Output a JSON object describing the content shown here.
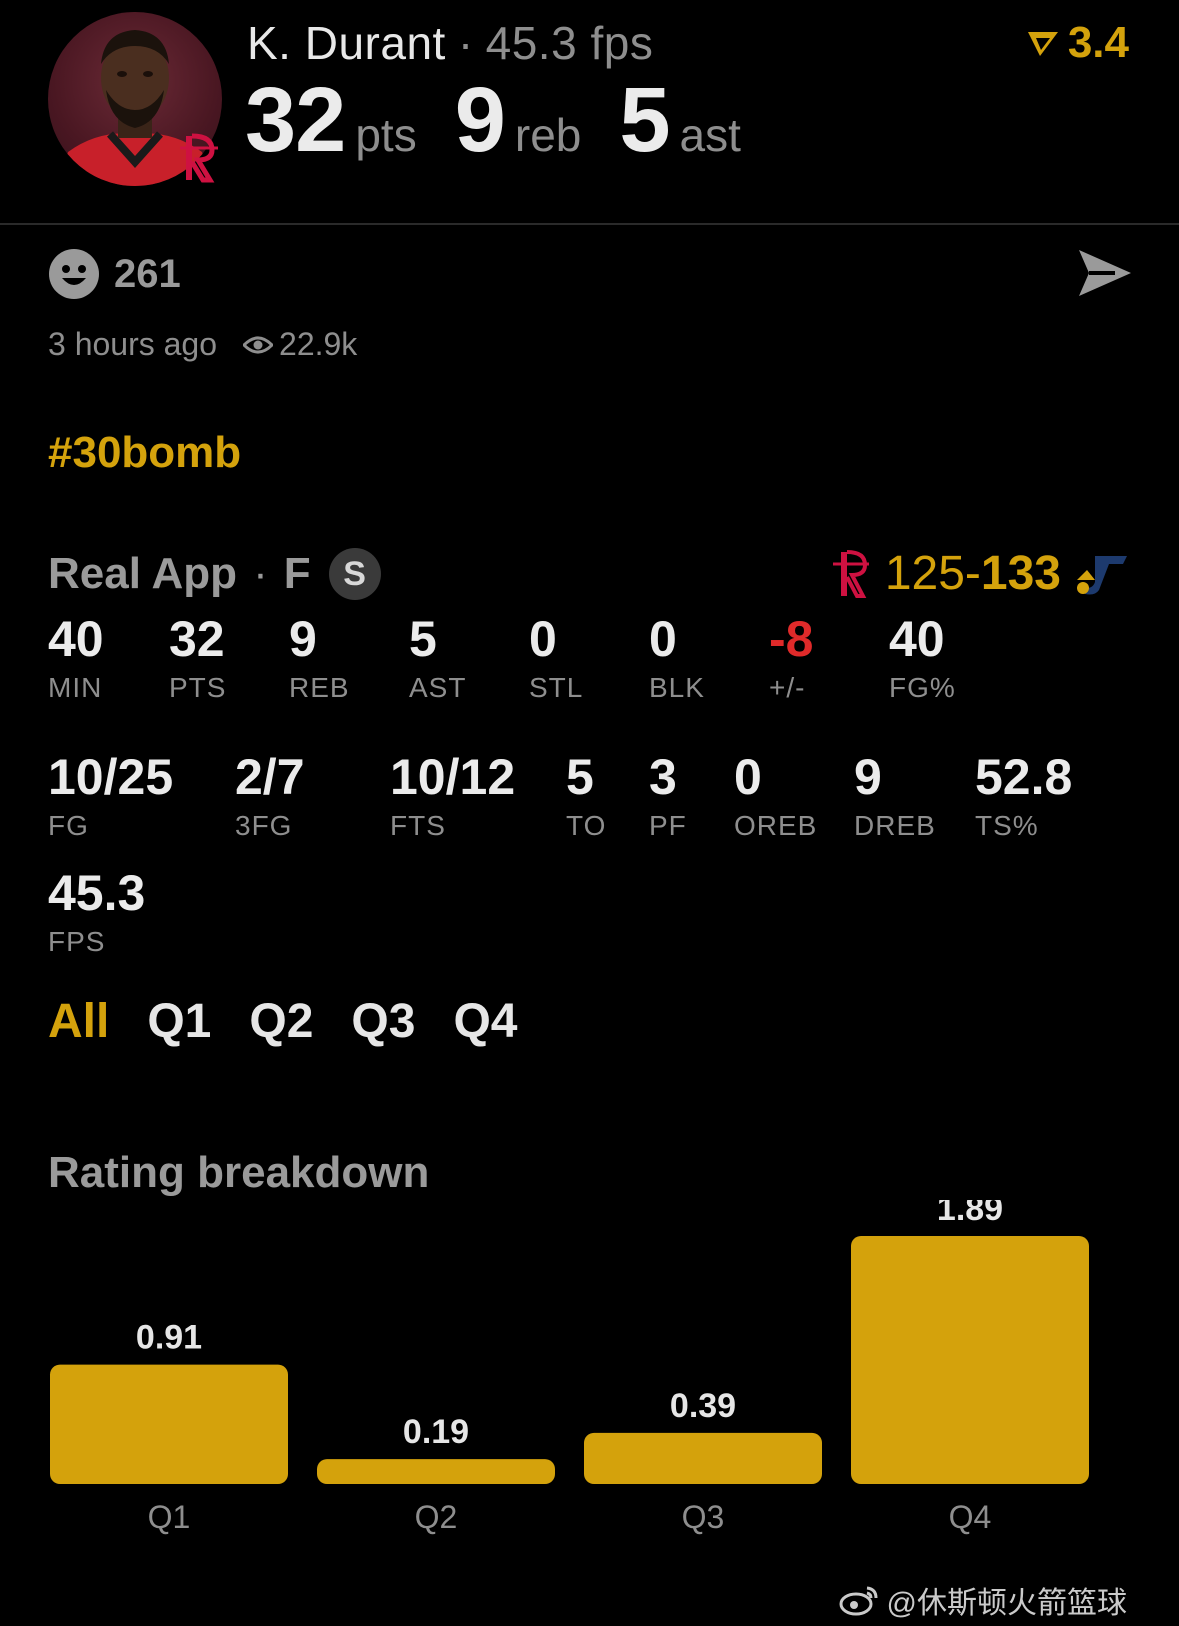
{
  "player": {
    "name": "K. Durant",
    "fps_label": "45.3 fps",
    "rating": "3.4",
    "pts": "32",
    "pts_unit": "pts",
    "reb": "9",
    "reb_unit": "reb",
    "ast": "5",
    "ast_unit": "ast"
  },
  "social": {
    "reaction_count": "261",
    "time_ago": "3 hours ago",
    "views": "22.9k",
    "hashtag": "#30bomb"
  },
  "game": {
    "app": "Real App",
    "status": "F",
    "badge": "S",
    "home_score": "125",
    "separator": "-",
    "away_score": "133"
  },
  "stats": [
    {
      "value": "40",
      "label": "MIN"
    },
    {
      "value": "32",
      "label": "PTS"
    },
    {
      "value": "9",
      "label": "REB"
    },
    {
      "value": "5",
      "label": "AST"
    },
    {
      "value": "0",
      "label": "STL"
    },
    {
      "value": "0",
      "label": "BLK"
    },
    {
      "value": "-8",
      "label": "+/-"
    },
    {
      "value": "40",
      "label": "FG%"
    },
    {
      "value": "10/25",
      "label": "FG"
    },
    {
      "value": "2/7",
      "label": "3FG"
    },
    {
      "value": "10/12",
      "label": "FTS"
    },
    {
      "value": "5",
      "label": "TO"
    },
    {
      "value": "3",
      "label": "PF"
    },
    {
      "value": "0",
      "label": "OREB"
    },
    {
      "value": "9",
      "label": "DREB"
    },
    {
      "value": "52.8",
      "label": "TS%"
    },
    {
      "value": "45.3",
      "label": "FPS"
    }
  ],
  "tabs": [
    "All",
    "Q1",
    "Q2",
    "Q3",
    "Q4"
  ],
  "active_tab": "All",
  "section_title": "Rating breakdown",
  "chart_data": {
    "type": "bar",
    "categories": [
      "Q1",
      "Q2",
      "Q3",
      "Q4"
    ],
    "values": [
      0.91,
      0.19,
      0.39,
      1.89
    ],
    "value_labels": [
      "0.91",
      "0.19",
      "0.39",
      "1.89"
    ],
    "ylim": [
      0,
      1.89
    ],
    "bar_color": "#d4a20c"
  },
  "watermark": "@休斯顿火箭篮球",
  "colors": {
    "accent": "#d4a20c",
    "negative": "#e02a2a",
    "muted": "#8e8e8e"
  }
}
